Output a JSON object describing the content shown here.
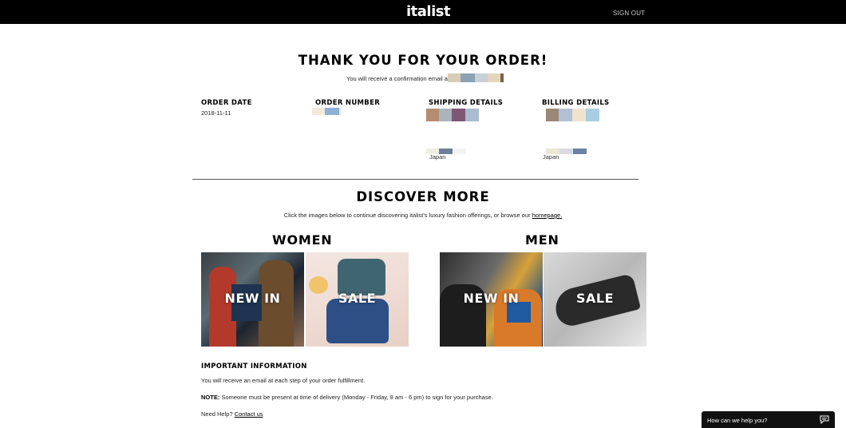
{
  "header": {
    "logo": "italist",
    "signout_label": "SIGN OUT"
  },
  "confirmation": {
    "title": "THANK YOU FOR YOUR ORDER!",
    "email_text": "You will receive a confirmation email at"
  },
  "order": {
    "date_label": "ORDER DATE",
    "date_value": "2018-11-11",
    "number_label": "ORDER NUMBER",
    "shipping_label": "SHIPPING DETAILS",
    "shipping_country": "Japan",
    "billing_label": "BILLING DETAILS",
    "billing_country": "Japan"
  },
  "discover": {
    "title": "DISCOVER MORE",
    "subtitle": "Click the images below to continue discovering italist's luxury fashion offerings, or browse our",
    "homepage_link": "homepage."
  },
  "categories": {
    "women": {
      "title": "WOMEN",
      "new_in": "NEW IN",
      "sale": "SALE"
    },
    "men": {
      "title": "MEN",
      "new_in": "NEW IN",
      "sale": "SALE"
    }
  },
  "info": {
    "title": "IMPORTANT INFORMATION",
    "line1": "You will receive an email at each step of your order fulfillment.",
    "note_label": "NOTE:",
    "note_text": "Someone must be present at time of delivery (Monday - Friday, 8 am - 6 pm) to sign for your purchase.",
    "help_text": "Need Help?",
    "contact_link": "Contact us"
  },
  "chat": {
    "label": "How can we help you?",
    "icon": "chat-bubble-icon"
  },
  "colors": {
    "topbar": "#000000",
    "background": "#ffffff",
    "text": "#000000"
  }
}
